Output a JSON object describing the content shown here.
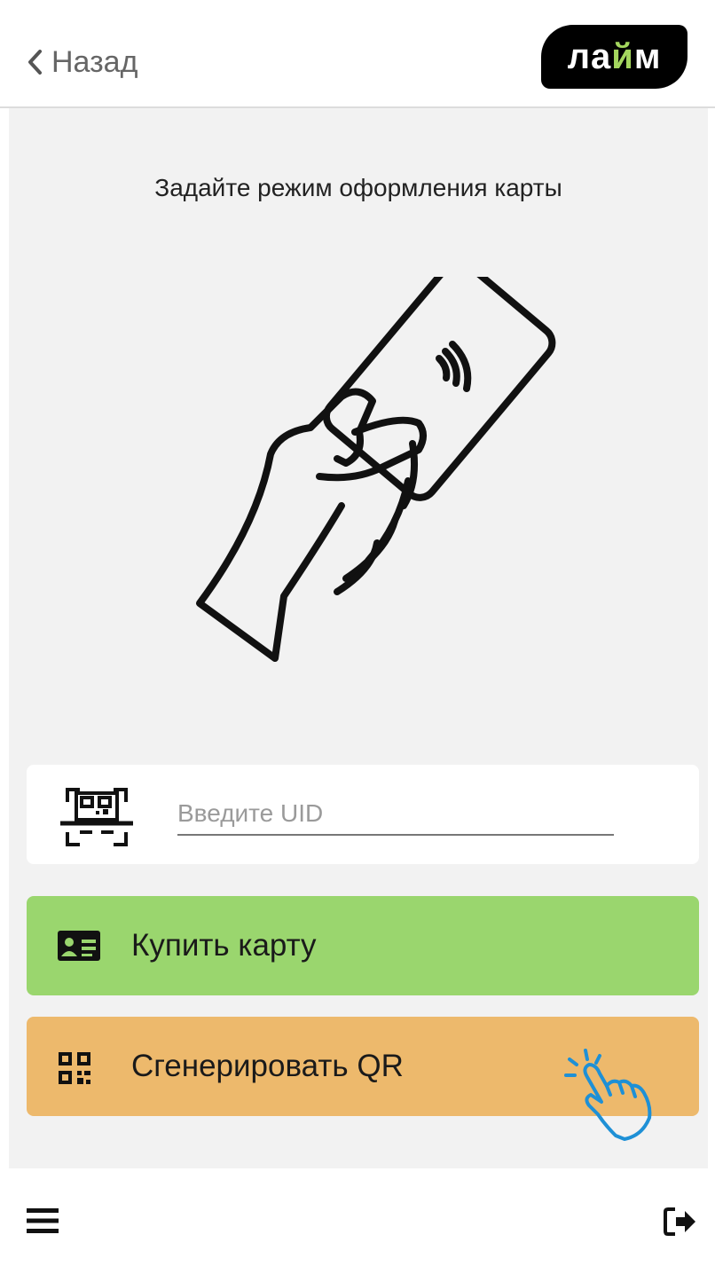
{
  "header": {
    "back_label": "Назад",
    "back_icon": "chevron-left-icon",
    "logo_text_start": "ла",
    "logo_text_accent": "й",
    "logo_text_end": "м"
  },
  "main": {
    "title": "Задайте режим оформления карты",
    "illustration_icon": "hand-holding-contactless-card-icon",
    "uid": {
      "icon": "qr-scan-icon",
      "placeholder": "Введите UID",
      "value": ""
    },
    "buy_button": {
      "icon": "id-card-icon",
      "label": "Купить карту",
      "color": "#9ad66e"
    },
    "qr_button": {
      "icon": "qr-code-icon",
      "label": "Сгенерировать QR",
      "color": "#edb96c",
      "hint_icon": "tap-hand-icon"
    }
  },
  "footer": {
    "menu_icon": "hamburger-menu-icon",
    "logout_icon": "logout-icon"
  },
  "colors": {
    "background": "#f2f2f2",
    "accent_green": "#a4d65e",
    "tap_hint_blue": "#1e90d6"
  }
}
